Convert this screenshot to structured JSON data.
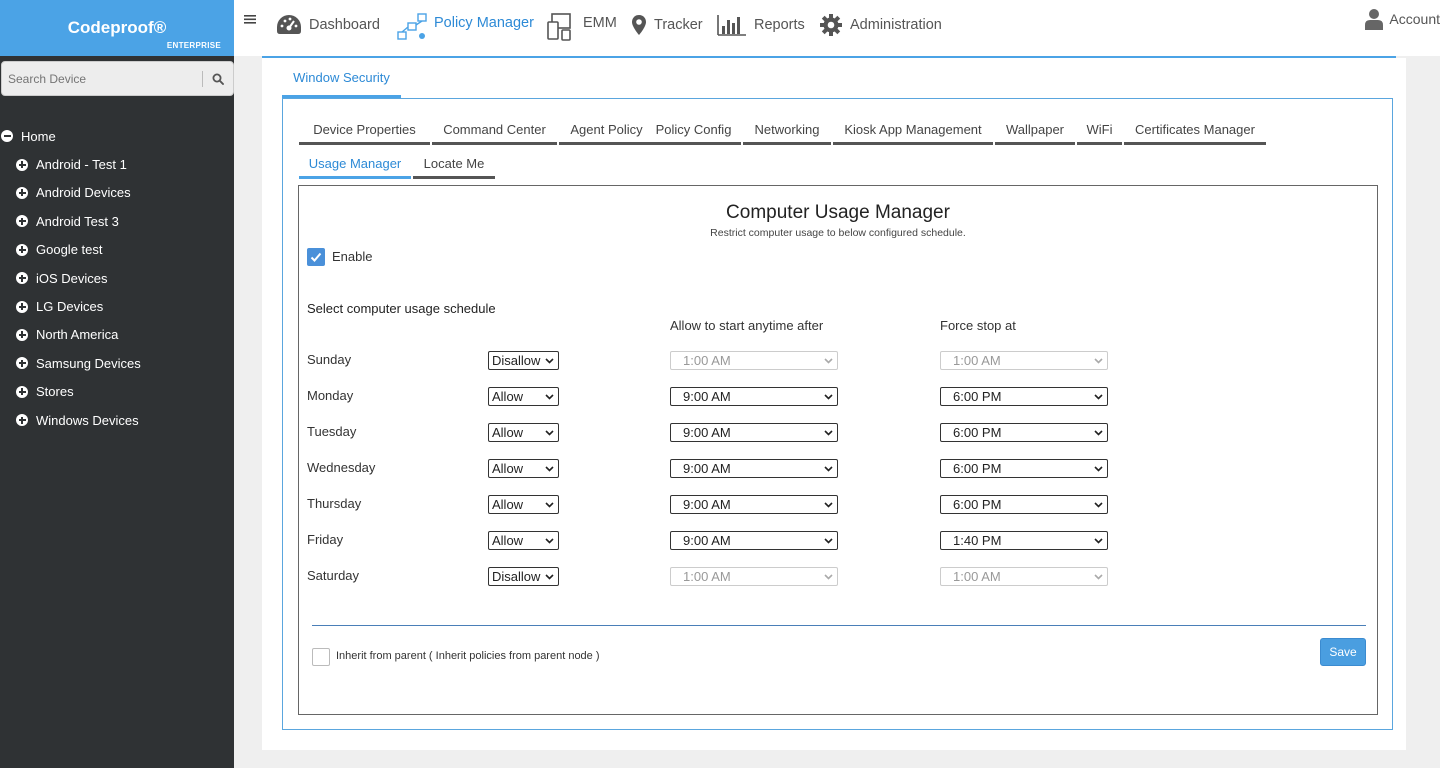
{
  "brand": {
    "name": "Codeproof®",
    "edition": "ENTERPRISE"
  },
  "search": {
    "placeholder": "Search Device",
    "icon": "search-icon"
  },
  "tree": {
    "root": "Home",
    "children": [
      "Android - Test 1",
      "Android Devices",
      "Android Test 3",
      "Google test",
      "iOS Devices",
      "LG Devices",
      "North America",
      "Samsung Devices",
      "Stores",
      "Windows Devices"
    ]
  },
  "nav": {
    "items": [
      {
        "label": "Dashboard",
        "icon": "dashboard-gauge-icon"
      },
      {
        "label": "Policy Manager",
        "icon": "policy-network-icon",
        "active": true
      },
      {
        "label": "EMM",
        "icon": "devices-icon"
      },
      {
        "label": "Tracker",
        "icon": "map-pin-icon"
      },
      {
        "label": "Reports",
        "icon": "bar-chart-icon"
      },
      {
        "label": "Administration",
        "icon": "gear-icon"
      }
    ],
    "account": "Account"
  },
  "section_tab": "Window Security",
  "tabs": [
    "Device Properties",
    "Command Center",
    "Agent Policy",
    "Policy Config",
    "Networking",
    "Kiosk App Management",
    "Wallpaper",
    "WiFi",
    "Certificates Manager",
    "Usage Manager",
    "Locate Me"
  ],
  "active_tab": "Usage Manager",
  "usage": {
    "title": "Computer Usage Manager",
    "subtitle": "Restrict computer usage to below configured schedule.",
    "enable_label": "Enable",
    "enable_checked": true,
    "select_label": "Select computer usage schedule",
    "col_start": "Allow to start anytime after",
    "col_stop": "Force stop at",
    "schedule": [
      {
        "day": "Sunday",
        "mode": "Disallow",
        "start": "1:00 AM",
        "stop": "1:00 AM"
      },
      {
        "day": "Monday",
        "mode": "Allow",
        "start": "9:00 AM",
        "stop": "6:00 PM"
      },
      {
        "day": "Tuesday",
        "mode": "Allow",
        "start": "9:00 AM",
        "stop": "6:00 PM"
      },
      {
        "day": "Wednesday",
        "mode": "Allow",
        "start": "9:00 AM",
        "stop": "6:00 PM"
      },
      {
        "day": "Thursday",
        "mode": "Allow",
        "start": "9:00 AM",
        "stop": "6:00 PM"
      },
      {
        "day": "Friday",
        "mode": "Allow",
        "start": "9:00 AM",
        "stop": "1:40 PM"
      },
      {
        "day": "Saturday",
        "mode": "Disallow",
        "start": "1:00 AM",
        "stop": "1:00 AM"
      }
    ],
    "inherit_label": "Inherit from parent ( Inherit policies from parent node )",
    "inherit_checked": false,
    "save_label": "Save"
  },
  "colors": {
    "accent": "#4ba3e6",
    "sidebar": "#2f3234",
    "active_text": "#2d8ad6"
  }
}
